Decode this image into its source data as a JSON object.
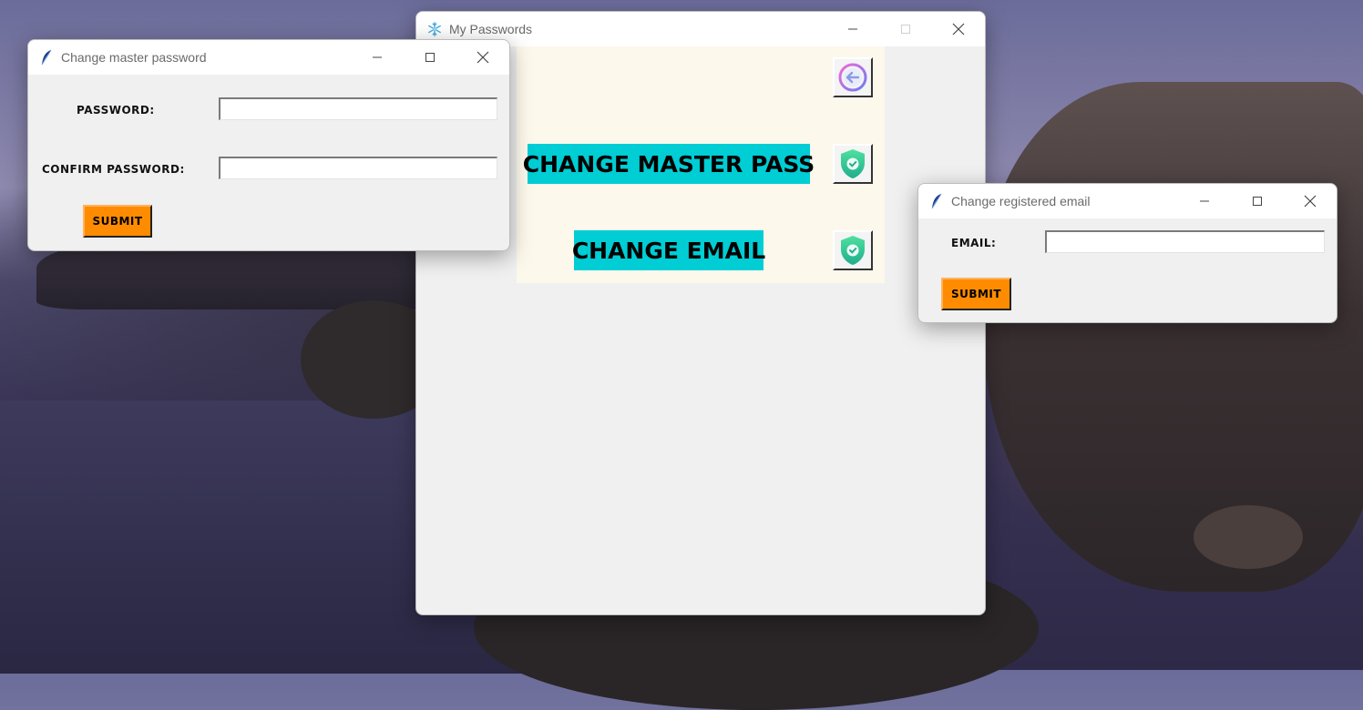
{
  "desktop": {},
  "main_window": {
    "title": "My Passwords",
    "buttons": {
      "change_master": "CHANGE MASTER PASS",
      "change_email": "CHANGE EMAIL"
    },
    "icons": {
      "back": "back-arrow-icon",
      "shield": "shield-check-icon",
      "app": "snowflake-icon"
    }
  },
  "master_window": {
    "title": "Change master password",
    "password_label": "PASSWORD:",
    "password_value": "",
    "confirm_label": "CONFIRM PASSWORD:",
    "confirm_value": "",
    "submit_label": "SUBMIT",
    "icon": "feather-icon"
  },
  "email_window": {
    "title": "Change registered email",
    "email_label": "EMAIL:",
    "email_value": "",
    "submit_label": "SUBMIT",
    "icon": "feather-icon"
  },
  "colors": {
    "accent_cyan": "#00cdd4",
    "submit_orange": "#ff8c00",
    "panel_cream": "#fdf8ec"
  }
}
